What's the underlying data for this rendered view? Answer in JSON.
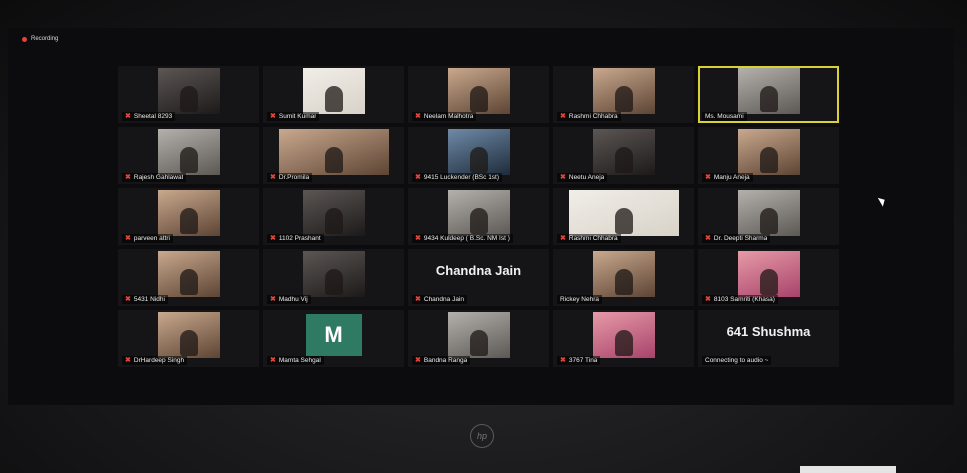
{
  "recording": {
    "label": "Recording"
  },
  "device": {
    "logo_text": "hp"
  },
  "participants": [
    {
      "name": "Sheetal 8293",
      "muted": true,
      "tile": "video",
      "tone": "dark"
    },
    {
      "name": "Sumit Kumar",
      "muted": true,
      "tile": "video",
      "tone": "light"
    },
    {
      "name": "Neelam Malhotra",
      "muted": true,
      "tile": "video",
      "tone": "warm"
    },
    {
      "name": "Rashmi Chhabra",
      "muted": true,
      "tile": "video",
      "tone": "warm"
    },
    {
      "name": "Ms. Mousami",
      "muted": false,
      "tile": "video",
      "tone": "gray",
      "active_speaker": true
    },
    {
      "name": "Rajesh Gahlawat",
      "muted": true,
      "tile": "video",
      "tone": "gray"
    },
    {
      "name": "Dr.Promila",
      "muted": true,
      "tile": "video",
      "tone": "warm",
      "wide": true
    },
    {
      "name": "9415 Luckender (BSc 1st)",
      "muted": true,
      "tile": "video",
      "tone": "blue"
    },
    {
      "name": "Neetu Aneja",
      "muted": true,
      "tile": "video",
      "tone": "dark"
    },
    {
      "name": "Manju Aneja",
      "muted": true,
      "tile": "video",
      "tone": "warm"
    },
    {
      "name": "parveen attri",
      "muted": true,
      "tile": "video",
      "tone": "warm"
    },
    {
      "name": "1102 Prashant",
      "muted": true,
      "tile": "video",
      "tone": "dark"
    },
    {
      "name": "9434 Kuldeep ( B.Sc. NM Ist )",
      "muted": true,
      "tile": "video",
      "tone": "gray"
    },
    {
      "name": "Rashmi Chhabra",
      "muted": true,
      "tile": "video",
      "tone": "light",
      "wide": true
    },
    {
      "name": "Dr. Deepti Sharma",
      "muted": true,
      "tile": "video",
      "tone": "gray"
    },
    {
      "name": "5431 Nidhi",
      "muted": true,
      "tile": "video",
      "tone": "warm"
    },
    {
      "name": "Madhu Vij",
      "muted": true,
      "tile": "video",
      "tone": "dark"
    },
    {
      "name": "Chandna Jain",
      "muted": true,
      "tile": "name",
      "display_name": "Chandna Jain"
    },
    {
      "name": "Rickey Nehra",
      "muted": false,
      "tile": "video",
      "tone": "warm"
    },
    {
      "name": "8103 Samriti (Khasa)",
      "muted": true,
      "tile": "video",
      "tone": "pink"
    },
    {
      "name": "DrHardeep Singh",
      "muted": true,
      "tile": "video",
      "tone": "warm"
    },
    {
      "name": "Mamta Sehgal",
      "muted": true,
      "tile": "avatar",
      "initial": "M"
    },
    {
      "name": "Bandna Ranga",
      "muted": true,
      "tile": "video",
      "tone": "gray"
    },
    {
      "name": "3767 Tina",
      "muted": true,
      "tile": "video",
      "tone": "pink"
    },
    {
      "name": "Connecting to audio ~",
      "muted": false,
      "tile": "name",
      "display_name": "641 Shushma"
    }
  ],
  "colors": {
    "active_border": "#d8d232",
    "muted_icon": "#e0453a",
    "avatar_bg": "#2f7a62"
  }
}
